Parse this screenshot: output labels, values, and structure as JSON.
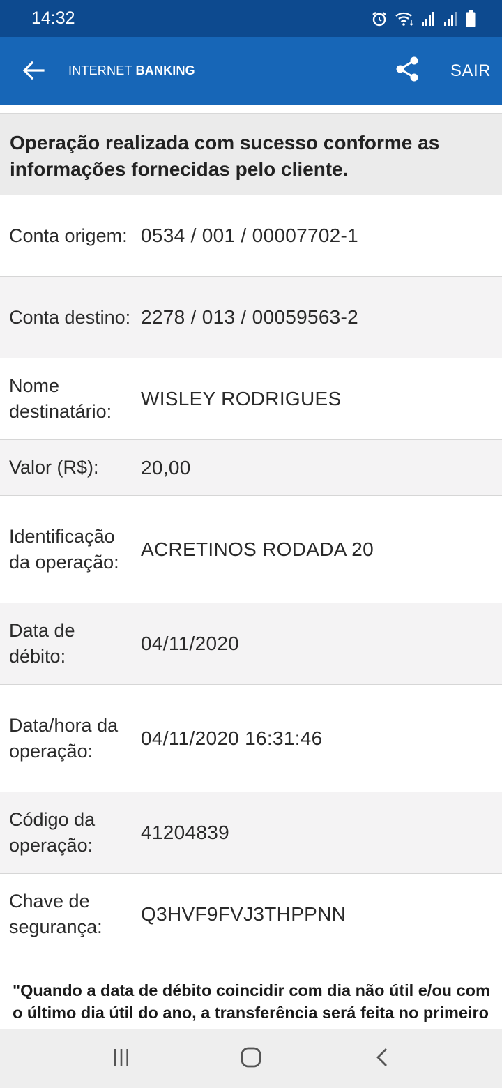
{
  "status_bar": {
    "time": "14:32",
    "icons": [
      "alarm-icon",
      "wifi-icon",
      "signal-icon",
      "signal-icon",
      "battery-icon"
    ]
  },
  "app_bar": {
    "back_icon": "arrow-left-icon",
    "brand_part1": "INTERNET ",
    "brand_part2": "BANKING",
    "share_icon": "share-icon",
    "exit_label": "SAIR",
    "color": "#1766b7",
    "status_color": "#0d4a8f"
  },
  "banner": {
    "text": "Operação realizada com sucesso conforme as informações fornecidas pelo cliente."
  },
  "details": [
    {
      "label": "Conta origem:",
      "value": "0534 / 001 / 00007702-1"
    },
    {
      "label": "Conta destino:",
      "value": "2278 / 013 / 00059563-2"
    },
    {
      "label": "Nome destinatário:",
      "value": "WISLEY RODRIGUES"
    },
    {
      "label": "Valor (R$):",
      "value": "20,00"
    },
    {
      "label": "Identificação da operação:",
      "value": "ACRETINOS RODADA 20"
    },
    {
      "label": "Data de débito:",
      "value": "04/11/2020"
    },
    {
      "label": "Data/hora da operação:",
      "value": "04/11/2020 16:31:46"
    },
    {
      "label": "Código da operação:",
      "value": "41204839"
    },
    {
      "label": "Chave de segurança:",
      "value": "Q3HVF9FVJ3THPPNN"
    }
  ],
  "note": {
    "text": "\"Quando a data de débito coincidir com dia não útil e/ou com o último dia útil do ano, a transferência será feita no primeiro dia útil subsequente.\""
  },
  "nav_bar": {
    "icons": [
      "recent-apps-icon",
      "home-icon",
      "back-icon"
    ]
  }
}
